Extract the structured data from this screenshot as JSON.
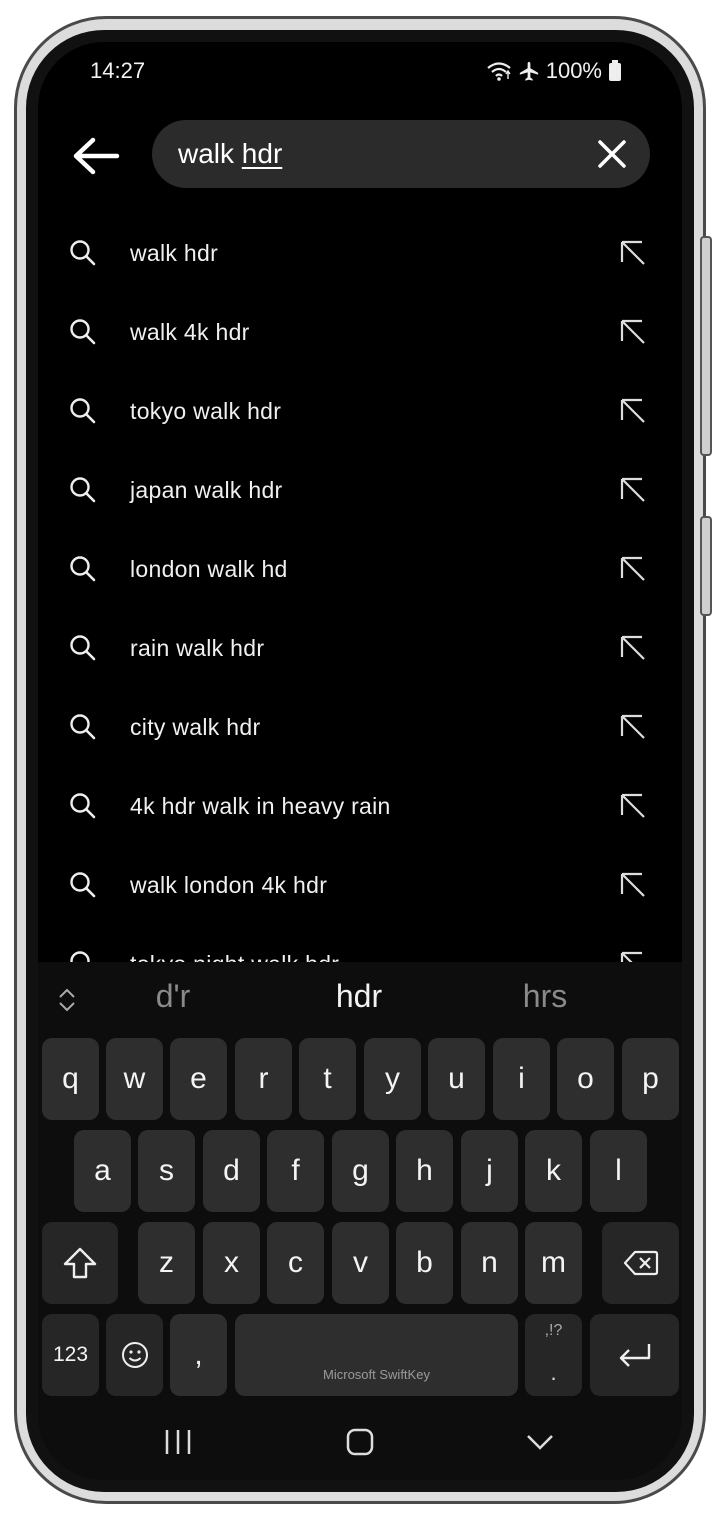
{
  "status_bar": {
    "time": "14:27",
    "battery": "100%",
    "icons": [
      "wifi-icon",
      "airplane-icon",
      "battery-icon"
    ]
  },
  "search": {
    "query_plain": "walk ",
    "query_underlined": "hdr"
  },
  "suggestions": [
    "walk hdr",
    "walk 4k hdr",
    "tokyo walk hdr",
    "japan walk hdr",
    "london walk hd",
    "rain walk hdr",
    "city walk hdr",
    "4k hdr walk in heavy rain",
    "walk london 4k hdr",
    "tokyo night walk hdr"
  ],
  "keyboard": {
    "word_suggestions": [
      "d'r",
      "hdr",
      "hrs"
    ],
    "row1": [
      "q",
      "w",
      "e",
      "r",
      "t",
      "y",
      "u",
      "i",
      "o",
      "p"
    ],
    "row2": [
      "a",
      "s",
      "d",
      "f",
      "g",
      "h",
      "j",
      "k",
      "l"
    ],
    "row3": [
      "z",
      "x",
      "c",
      "v",
      "b",
      "n",
      "m"
    ],
    "numbers_key": "123",
    "comma_key": ",",
    "space_brand": "Microsoft SwiftKey",
    "punct_top": ",!?",
    "punct_bottom": "."
  },
  "colors": {
    "background": "#000000",
    "search_box": "#2b2b2b",
    "key": "#2e2e2e",
    "keyboard_bg": "#0d0d0d"
  }
}
